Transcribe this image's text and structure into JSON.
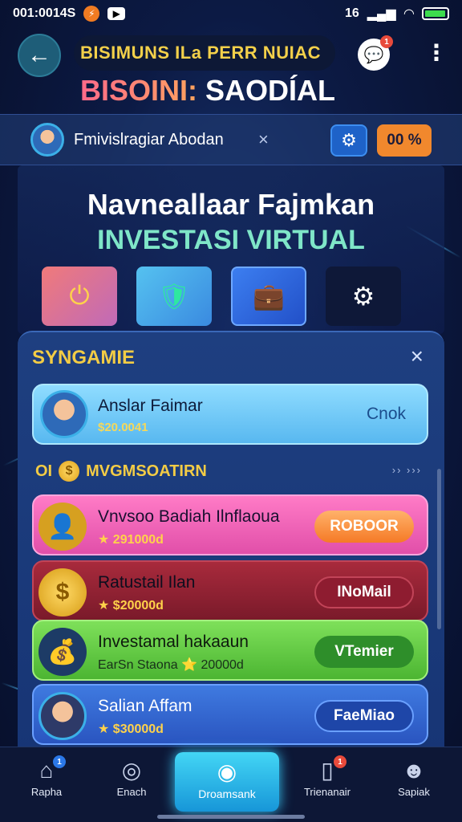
{
  "status_bar": {
    "time": "001:0014S",
    "network": "16",
    "signal_icon": "signal-icon",
    "wifi_icon": "wifi-icon",
    "battery_level": 0.95
  },
  "header": {
    "pill_text": "BISIMUNS ILa PERR NUIAC",
    "message_badge": "1",
    "title_part1": "BISOINI:",
    "title_part2": "SAODÍAL"
  },
  "profile": {
    "name": "Fmivislragiar Abodan",
    "close_glyph": "×",
    "percent_label": "00 %"
  },
  "hero": {
    "title": "Navneallaar Fajmkan",
    "subtitle": "INVESTASI VIRTUAL"
  },
  "section": {
    "title": "SYNGAMIE",
    "close_glyph": "×",
    "featured": {
      "name": "Anslar Faimar",
      "value": "$20.0041",
      "action": "Cnok"
    },
    "subheading": "MVGMSOATIRN",
    "subheading_prefix": "OI",
    "more_arrows": "›› ›››",
    "items": [
      {
        "name": "Vnvsoo Badiah Ilnflaoua",
        "value": "★ 291000d",
        "button": "ROBOOR"
      },
      {
        "name": "Ratustail Ilan",
        "value": "★ $20000d",
        "button": "INoMail"
      },
      {
        "name": "Investamal hakaaun",
        "value": "EarSn Staona ⭐ 20000d",
        "button": "VTemier"
      },
      {
        "name": "Salian Affam",
        "value": "★ $30000d",
        "button": "FaeMiao"
      }
    ]
  },
  "bottom_nav": {
    "items": [
      {
        "label": "Rapha",
        "badge": "1"
      },
      {
        "label": "Enach"
      },
      {
        "label": "Droamsank"
      },
      {
        "label": "Trienanair",
        "badge": "1"
      },
      {
        "label": "Sapiak"
      }
    ]
  },
  "colors": {
    "accent_gold": "#f3cc45",
    "accent_cyan": "#43d6f5",
    "badge_red": "#e84a3b"
  }
}
